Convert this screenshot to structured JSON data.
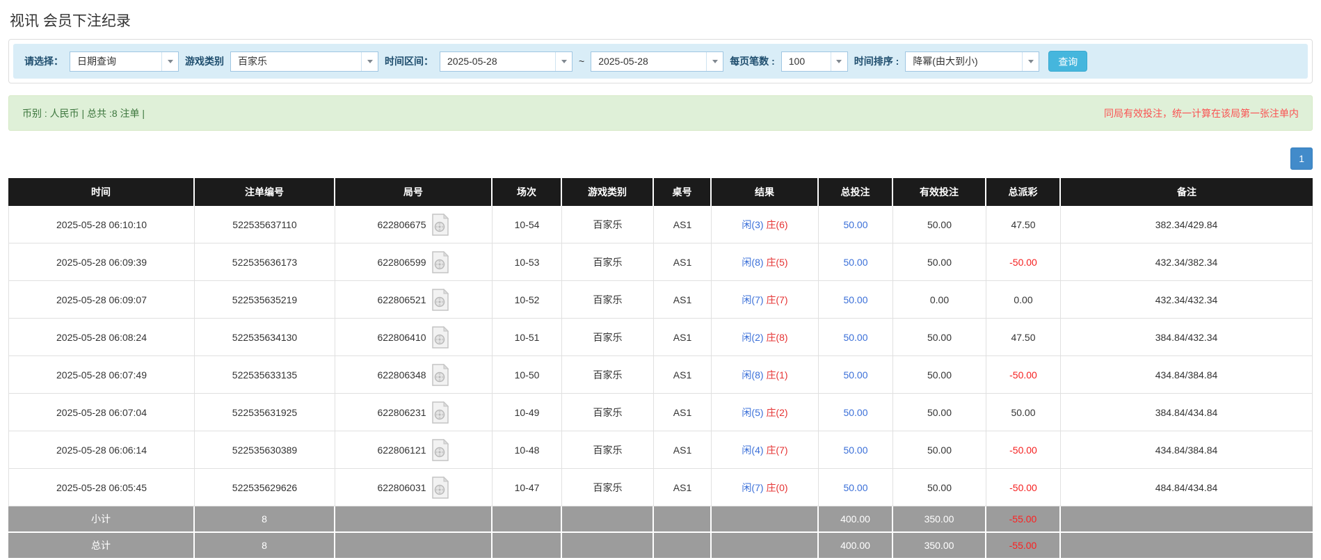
{
  "page": {
    "title": "视讯 会员下注纪录"
  },
  "filters": {
    "select_label": "请选择：",
    "select_value": "日期查询",
    "game_type_label": "游戏类别",
    "game_type_value": "百家乐",
    "time_range_label": "时间区间：",
    "date_from": "2025-05-28",
    "date_separator": "~",
    "date_to": "2025-05-28",
    "page_size_label": "每页笔数 :",
    "page_size_value": "100",
    "sort_label": "时间排序 :",
    "sort_value": "降幂(由大到小)",
    "search_button": "查询"
  },
  "summary": {
    "left": "币别 : 人民币 | 总共 :8 注单 |",
    "right_note": "同局有效投注，统一计算在该局第一张注单内"
  },
  "pagination": {
    "current": "1"
  },
  "colors": {
    "accent_blue": "#428bca",
    "filter_bar_bg": "#d9edf7",
    "summary_bg": "#dff0d8",
    "summary_text": "#3c763d",
    "note_red": "#fa5252",
    "player_blue": "#3a6fd8",
    "banker_red": "#e53333",
    "negative_red": "#f51f1f",
    "header_bg": "#1b1b1b",
    "footer_bg": "#9c9c9c"
  },
  "icons": {
    "dropdown_arrow": "chevron-down",
    "round_video": "video-replay-file"
  },
  "table": {
    "headers": [
      "时间",
      "注单编号",
      "局号",
      "场次",
      "游戏类别",
      "桌号",
      "结果",
      "总投注",
      "有效投注",
      "总派彩",
      "备注"
    ],
    "rows": [
      {
        "time": "2025-05-28 06:10:10",
        "bet_id": "522535637110",
        "round": "622806675",
        "session": "10-54",
        "game": "百家乐",
        "table_no": "AS1",
        "result_player": "闲(3)",
        "result_banker": "庄(6)",
        "total_bet": "50.00",
        "valid_bet": "50.00",
        "payout": "47.50",
        "note": "382.34/429.84"
      },
      {
        "time": "2025-05-28 06:09:39",
        "bet_id": "522535636173",
        "round": "622806599",
        "session": "10-53",
        "game": "百家乐",
        "table_no": "AS1",
        "result_player": "闲(8)",
        "result_banker": "庄(5)",
        "total_bet": "50.00",
        "valid_bet": "50.00",
        "payout": "-50.00",
        "note": "432.34/382.34"
      },
      {
        "time": "2025-05-28 06:09:07",
        "bet_id": "522535635219",
        "round": "622806521",
        "session": "10-52",
        "game": "百家乐",
        "table_no": "AS1",
        "result_player": "闲(7)",
        "result_banker": "庄(7)",
        "total_bet": "50.00",
        "valid_bet": "0.00",
        "payout": "0.00",
        "note": "432.34/432.34"
      },
      {
        "time": "2025-05-28 06:08:24",
        "bet_id": "522535634130",
        "round": "622806410",
        "session": "10-51",
        "game": "百家乐",
        "table_no": "AS1",
        "result_player": "闲(2)",
        "result_banker": "庄(8)",
        "total_bet": "50.00",
        "valid_bet": "50.00",
        "payout": "47.50",
        "note": "384.84/432.34"
      },
      {
        "time": "2025-05-28 06:07:49",
        "bet_id": "522535633135",
        "round": "622806348",
        "session": "10-50",
        "game": "百家乐",
        "table_no": "AS1",
        "result_player": "闲(8)",
        "result_banker": "庄(1)",
        "total_bet": "50.00",
        "valid_bet": "50.00",
        "payout": "-50.00",
        "note": "434.84/384.84"
      },
      {
        "time": "2025-05-28 06:07:04",
        "bet_id": "522535631925",
        "round": "622806231",
        "session": "10-49",
        "game": "百家乐",
        "table_no": "AS1",
        "result_player": "闲(5)",
        "result_banker": "庄(2)",
        "total_bet": "50.00",
        "valid_bet": "50.00",
        "payout": "50.00",
        "note": "384.84/434.84"
      },
      {
        "time": "2025-05-28 06:06:14",
        "bet_id": "522535630389",
        "round": "622806121",
        "session": "10-48",
        "game": "百家乐",
        "table_no": "AS1",
        "result_player": "闲(4)",
        "result_banker": "庄(7)",
        "total_bet": "50.00",
        "valid_bet": "50.00",
        "payout": "-50.00",
        "note": "434.84/384.84"
      },
      {
        "time": "2025-05-28 06:05:45",
        "bet_id": "522535629626",
        "round": "622806031",
        "session": "10-47",
        "game": "百家乐",
        "table_no": "AS1",
        "result_player": "闲(7)",
        "result_banker": "庄(0)",
        "total_bet": "50.00",
        "valid_bet": "50.00",
        "payout": "-50.00",
        "note": "484.84/434.84"
      }
    ],
    "footer": [
      {
        "label": "小计",
        "count": "8",
        "total_bet": "400.00",
        "valid_bet": "350.00",
        "payout": "-55.00"
      },
      {
        "label": "总计",
        "count": "8",
        "total_bet": "400.00",
        "valid_bet": "350.00",
        "payout": "-55.00"
      }
    ]
  }
}
